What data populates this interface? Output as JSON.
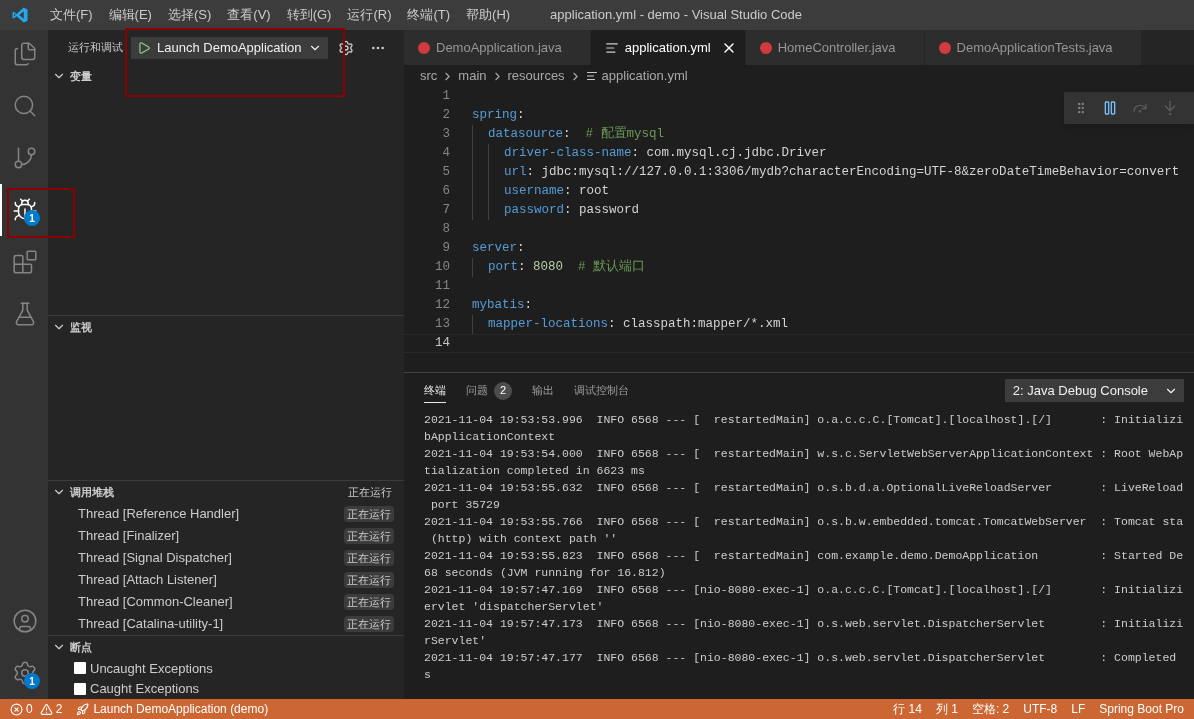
{
  "title_bar": {
    "menus": [
      "文件(F)",
      "编辑(E)",
      "选择(S)",
      "查看(V)",
      "转到(G)",
      "运行(R)",
      "终端(T)",
      "帮助(H)"
    ],
    "title": "application.yml - demo - Visual Studio Code"
  },
  "activity_bar": {
    "top": [
      {
        "kind": "files",
        "selected": false
      },
      {
        "kind": "search",
        "selected": false
      },
      {
        "kind": "source-control",
        "selected": false
      },
      {
        "kind": "run-debug",
        "selected": true,
        "badge": "1"
      },
      {
        "kind": "extensions",
        "selected": false
      },
      {
        "kind": "testing",
        "selected": false
      }
    ],
    "bottom": [
      {
        "kind": "account"
      },
      {
        "kind": "settings",
        "badge": "1"
      }
    ]
  },
  "sidebar": {
    "title": "运行和调试",
    "launch_config": "Launch DemoApplication",
    "variables": {
      "title": "变量",
      "expanded": true
    },
    "watch": {
      "title": "监视",
      "expanded": true
    },
    "call_stack": {
      "title": "调用堆栈",
      "expanded": true,
      "status": "正在运行",
      "threads": [
        {
          "name": "Thread [Reference Handler]",
          "status": "正在运行"
        },
        {
          "name": "Thread [Finalizer]",
          "status": "正在运行"
        },
        {
          "name": "Thread [Signal Dispatcher]",
          "status": "正在运行"
        },
        {
          "name": "Thread [Attach Listener]",
          "status": "正在运行"
        },
        {
          "name": "Thread [Common-Cleaner]",
          "status": "正在运行"
        },
        {
          "name": "Thread [Catalina-utility-1]",
          "status": "正在运行"
        }
      ]
    },
    "breakpoints": {
      "title": "断点",
      "expanded": true,
      "items": [
        {
          "label": "Uncaught Exceptions",
          "checked": false
        },
        {
          "label": "Caught Exceptions",
          "checked": false
        }
      ]
    }
  },
  "tabs": [
    {
      "label": "DemoApplication.java",
      "kind": "java",
      "selected": false
    },
    {
      "label": "application.yml",
      "kind": "yaml",
      "selected": true
    },
    {
      "label": "HomeController.java",
      "kind": "java",
      "selected": false
    },
    {
      "label": "DemoApplicationTests.java",
      "kind": "java",
      "selected": false
    }
  ],
  "breadcrumb": [
    "src",
    "main",
    "resources",
    "application.yml"
  ],
  "code_lines": [
    {
      "number": "1",
      "current": false
    },
    {
      "number": "2",
      "current": false,
      "tokens": [
        {
          "kind": "key",
          "text": "spring"
        },
        {
          "kind": "plain",
          "text": ":"
        }
      ]
    },
    {
      "number": "3",
      "current": false,
      "tokens": [
        {
          "kind": "key",
          "text": "  datasource"
        },
        {
          "kind": "plain",
          "text": ":"
        },
        {
          "kind": "comment",
          "text": "  # 配置mysql"
        }
      ]
    },
    {
      "number": "4",
      "current": false,
      "tokens": [
        {
          "kind": "key",
          "text": "    driver-class-name"
        },
        {
          "kind": "plain",
          "text": ": com.mysql.cj.jdbc.Driver"
        }
      ]
    },
    {
      "number": "5",
      "current": false,
      "tokens": [
        {
          "kind": "key",
          "text": "    url"
        },
        {
          "kind": "plain",
          "text": ": jdbc:mysql://127.0.0.1:3306/mydb?characterEncoding=UTF-8&zeroDateTimeBehavior=convert"
        }
      ]
    },
    {
      "number": "6",
      "current": false,
      "tokens": [
        {
          "kind": "key",
          "text": "    username"
        },
        {
          "kind": "plain",
          "text": ": root"
        }
      ]
    },
    {
      "number": "7",
      "current": false,
      "tokens": [
        {
          "kind": "key",
          "text": "    password"
        },
        {
          "kind": "plain",
          "text": ": password"
        }
      ]
    },
    {
      "number": "8",
      "current": false
    },
    {
      "number": "9",
      "current": false,
      "tokens": [
        {
          "kind": "key",
          "text": "server"
        },
        {
          "kind": "plain",
          "text": ":"
        }
      ]
    },
    {
      "number": "10",
      "current": false,
      "tokens": [
        {
          "kind": "key",
          "text": "  port"
        },
        {
          "kind": "plain",
          "text": ": "
        },
        {
          "kind": "number",
          "text": "8080"
        },
        {
          "kind": "comment",
          "text": "  # 默认端口"
        }
      ]
    },
    {
      "number": "11",
      "current": false
    },
    {
      "number": "12",
      "current": false,
      "tokens": [
        {
          "kind": "key",
          "text": "mybatis"
        },
        {
          "kind": "plain",
          "text": ":"
        }
      ]
    },
    {
      "number": "13",
      "current": false,
      "tokens": [
        {
          "kind": "key",
          "text": "  mapper-locations"
        },
        {
          "kind": "plain",
          "text": ": classpath:mapper/*.xml"
        }
      ]
    },
    {
      "number": "14",
      "current": true
    }
  ],
  "panel": {
    "tabs": [
      {
        "label": "终端",
        "selected": true
      },
      {
        "label": "问题",
        "selected": false,
        "badge": "2"
      },
      {
        "label": "输出",
        "selected": false
      },
      {
        "label": "调试控制台",
        "selected": false
      }
    ],
    "terminal_select": "2: Java Debug Console",
    "terminal_lines": [
      "2021-11-04 19:53:53.996  INFO 6568 --- [  restartedMain] o.a.c.c.C.[Tomcat].[localhost].[/]       : Initializi",
      "bApplicationContext",
      "2021-11-04 19:53:54.000  INFO 6568 --- [  restartedMain] w.s.c.ServletWebServerApplicationContext : Root WebAp",
      "tialization completed in 6623 ms",
      "2021-11-04 19:53:55.632  INFO 6568 --- [  restartedMain] o.s.b.d.a.OptionalLiveReloadServer       : LiveReload",
      " port 35729",
      "2021-11-04 19:53:55.766  INFO 6568 --- [  restartedMain] o.s.b.w.embedded.tomcat.TomcatWebServer  : Tomcat sta",
      " (http) with context path ''",
      "2021-11-04 19:53:55.823  INFO 6568 --- [  restartedMain] com.example.demo.DemoApplication         : Started De",
      "68 seconds (JVM running for 16.812)",
      "2021-11-04 19:57:47.169  INFO 6568 --- [nio-8080-exec-1] o.a.c.c.C.[Tomcat].[localhost].[/]       : Initializi",
      "ervlet 'dispatcherServlet'",
      "2021-11-04 19:57:47.173  INFO 6568 --- [nio-8080-exec-1] o.s.web.servlet.DispatcherServlet        : Initializi",
      "rServlet'",
      "2021-11-04 19:57:47.177  INFO 6568 --- [nio-8080-exec-1] o.s.web.servlet.DispatcherServlet        : Completed",
      "s"
    ]
  },
  "status_bar": {
    "errors": "0",
    "warnings": "2",
    "launch": "Launch DemoApplication (demo)",
    "right": [
      "行 14",
      "列 1",
      "空格: 2",
      "UTF-8",
      "LF",
      "Spring Boot Pro"
    ]
  }
}
